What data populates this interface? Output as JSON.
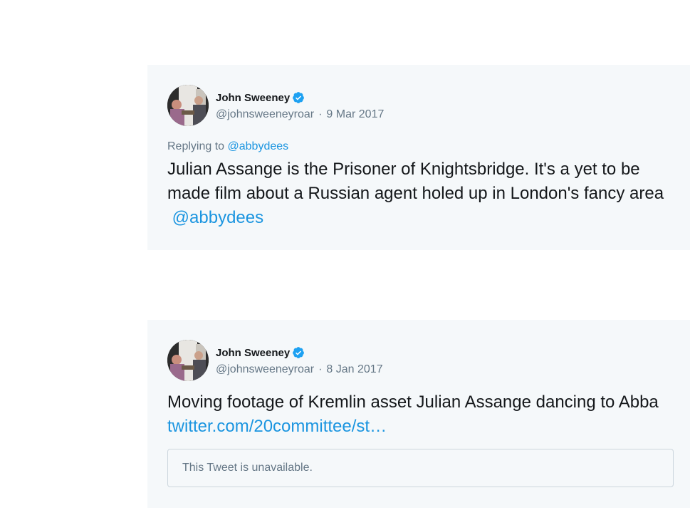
{
  "tweets": [
    {
      "author_name": "John Sweeney",
      "handle": "@johnsweeneyroar",
      "separator": "·",
      "date": "9 Mar 2017",
      "replying_prefix": "Replying to",
      "replying_to": "@abbydees",
      "text": "Julian Assange is the Prisoner of Knightsbridge. It's a yet to be made film about a Russian agent holed up in London's fancy area ",
      "text_link": "@abbydees",
      "verified_icon": "verified-badge-icon"
    },
    {
      "author_name": "John Sweeney",
      "handle": "@johnsweeneyroar",
      "separator": "·",
      "date": "8 Jan 2017",
      "text": "Moving footage of Kremlin asset Julian Assange dancing to Abba ",
      "text_link": "twitter.com/20committee/st…",
      "quoted_unavailable": "This Tweet is unavailable.",
      "verified_icon": "verified-badge-icon"
    }
  ],
  "colors": {
    "card_bg": "#f5f8fa",
    "link": "#1b95e0",
    "muted": "#657786",
    "text": "#14171a",
    "verified": "#1da1f2"
  }
}
